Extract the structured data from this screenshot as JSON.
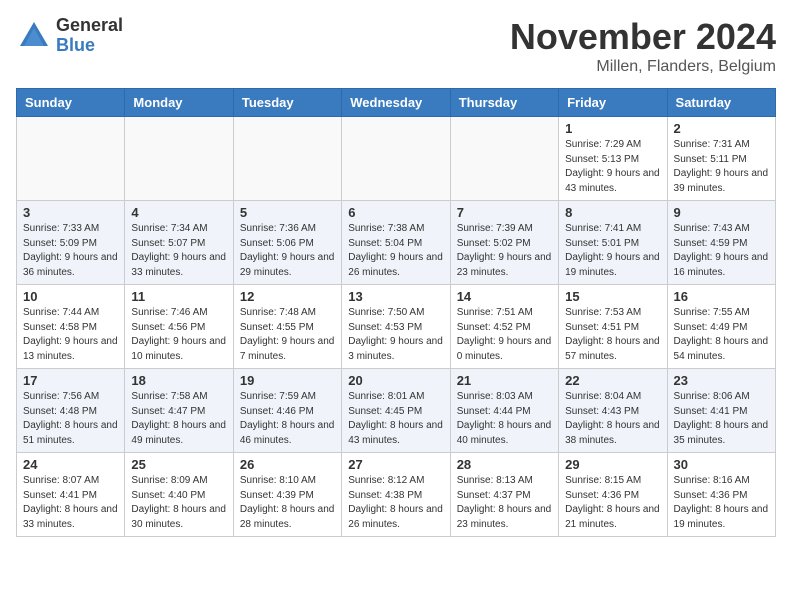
{
  "logo": {
    "general": "General",
    "blue": "Blue"
  },
  "title": "November 2024",
  "location": "Millen, Flanders, Belgium",
  "headers": [
    "Sunday",
    "Monday",
    "Tuesday",
    "Wednesday",
    "Thursday",
    "Friday",
    "Saturday"
  ],
  "weeks": [
    [
      {
        "day": "",
        "sunrise": "",
        "sunset": "",
        "daylight": ""
      },
      {
        "day": "",
        "sunrise": "",
        "sunset": "",
        "daylight": ""
      },
      {
        "day": "",
        "sunrise": "",
        "sunset": "",
        "daylight": ""
      },
      {
        "day": "",
        "sunrise": "",
        "sunset": "",
        "daylight": ""
      },
      {
        "day": "",
        "sunrise": "",
        "sunset": "",
        "daylight": ""
      },
      {
        "day": "1",
        "sunrise": "Sunrise: 7:29 AM",
        "sunset": "Sunset: 5:13 PM",
        "daylight": "Daylight: 9 hours and 43 minutes."
      },
      {
        "day": "2",
        "sunrise": "Sunrise: 7:31 AM",
        "sunset": "Sunset: 5:11 PM",
        "daylight": "Daylight: 9 hours and 39 minutes."
      }
    ],
    [
      {
        "day": "3",
        "sunrise": "Sunrise: 7:33 AM",
        "sunset": "Sunset: 5:09 PM",
        "daylight": "Daylight: 9 hours and 36 minutes."
      },
      {
        "day": "4",
        "sunrise": "Sunrise: 7:34 AM",
        "sunset": "Sunset: 5:07 PM",
        "daylight": "Daylight: 9 hours and 33 minutes."
      },
      {
        "day": "5",
        "sunrise": "Sunrise: 7:36 AM",
        "sunset": "Sunset: 5:06 PM",
        "daylight": "Daylight: 9 hours and 29 minutes."
      },
      {
        "day": "6",
        "sunrise": "Sunrise: 7:38 AM",
        "sunset": "Sunset: 5:04 PM",
        "daylight": "Daylight: 9 hours and 26 minutes."
      },
      {
        "day": "7",
        "sunrise": "Sunrise: 7:39 AM",
        "sunset": "Sunset: 5:02 PM",
        "daylight": "Daylight: 9 hours and 23 minutes."
      },
      {
        "day": "8",
        "sunrise": "Sunrise: 7:41 AM",
        "sunset": "Sunset: 5:01 PM",
        "daylight": "Daylight: 9 hours and 19 minutes."
      },
      {
        "day": "9",
        "sunrise": "Sunrise: 7:43 AM",
        "sunset": "Sunset: 4:59 PM",
        "daylight": "Daylight: 9 hours and 16 minutes."
      }
    ],
    [
      {
        "day": "10",
        "sunrise": "Sunrise: 7:44 AM",
        "sunset": "Sunset: 4:58 PM",
        "daylight": "Daylight: 9 hours and 13 minutes."
      },
      {
        "day": "11",
        "sunrise": "Sunrise: 7:46 AM",
        "sunset": "Sunset: 4:56 PM",
        "daylight": "Daylight: 9 hours and 10 minutes."
      },
      {
        "day": "12",
        "sunrise": "Sunrise: 7:48 AM",
        "sunset": "Sunset: 4:55 PM",
        "daylight": "Daylight: 9 hours and 7 minutes."
      },
      {
        "day": "13",
        "sunrise": "Sunrise: 7:50 AM",
        "sunset": "Sunset: 4:53 PM",
        "daylight": "Daylight: 9 hours and 3 minutes."
      },
      {
        "day": "14",
        "sunrise": "Sunrise: 7:51 AM",
        "sunset": "Sunset: 4:52 PM",
        "daylight": "Daylight: 9 hours and 0 minutes."
      },
      {
        "day": "15",
        "sunrise": "Sunrise: 7:53 AM",
        "sunset": "Sunset: 4:51 PM",
        "daylight": "Daylight: 8 hours and 57 minutes."
      },
      {
        "day": "16",
        "sunrise": "Sunrise: 7:55 AM",
        "sunset": "Sunset: 4:49 PM",
        "daylight": "Daylight: 8 hours and 54 minutes."
      }
    ],
    [
      {
        "day": "17",
        "sunrise": "Sunrise: 7:56 AM",
        "sunset": "Sunset: 4:48 PM",
        "daylight": "Daylight: 8 hours and 51 minutes."
      },
      {
        "day": "18",
        "sunrise": "Sunrise: 7:58 AM",
        "sunset": "Sunset: 4:47 PM",
        "daylight": "Daylight: 8 hours and 49 minutes."
      },
      {
        "day": "19",
        "sunrise": "Sunrise: 7:59 AM",
        "sunset": "Sunset: 4:46 PM",
        "daylight": "Daylight: 8 hours and 46 minutes."
      },
      {
        "day": "20",
        "sunrise": "Sunrise: 8:01 AM",
        "sunset": "Sunset: 4:45 PM",
        "daylight": "Daylight: 8 hours and 43 minutes."
      },
      {
        "day": "21",
        "sunrise": "Sunrise: 8:03 AM",
        "sunset": "Sunset: 4:44 PM",
        "daylight": "Daylight: 8 hours and 40 minutes."
      },
      {
        "day": "22",
        "sunrise": "Sunrise: 8:04 AM",
        "sunset": "Sunset: 4:43 PM",
        "daylight": "Daylight: 8 hours and 38 minutes."
      },
      {
        "day": "23",
        "sunrise": "Sunrise: 8:06 AM",
        "sunset": "Sunset: 4:41 PM",
        "daylight": "Daylight: 8 hours and 35 minutes."
      }
    ],
    [
      {
        "day": "24",
        "sunrise": "Sunrise: 8:07 AM",
        "sunset": "Sunset: 4:41 PM",
        "daylight": "Daylight: 8 hours and 33 minutes."
      },
      {
        "day": "25",
        "sunrise": "Sunrise: 8:09 AM",
        "sunset": "Sunset: 4:40 PM",
        "daylight": "Daylight: 8 hours and 30 minutes."
      },
      {
        "day": "26",
        "sunrise": "Sunrise: 8:10 AM",
        "sunset": "Sunset: 4:39 PM",
        "daylight": "Daylight: 8 hours and 28 minutes."
      },
      {
        "day": "27",
        "sunrise": "Sunrise: 8:12 AM",
        "sunset": "Sunset: 4:38 PM",
        "daylight": "Daylight: 8 hours and 26 minutes."
      },
      {
        "day": "28",
        "sunrise": "Sunrise: 8:13 AM",
        "sunset": "Sunset: 4:37 PM",
        "daylight": "Daylight: 8 hours and 23 minutes."
      },
      {
        "day": "29",
        "sunrise": "Sunrise: 8:15 AM",
        "sunset": "Sunset: 4:36 PM",
        "daylight": "Daylight: 8 hours and 21 minutes."
      },
      {
        "day": "30",
        "sunrise": "Sunrise: 8:16 AM",
        "sunset": "Sunset: 4:36 PM",
        "daylight": "Daylight: 8 hours and 19 minutes."
      }
    ]
  ]
}
